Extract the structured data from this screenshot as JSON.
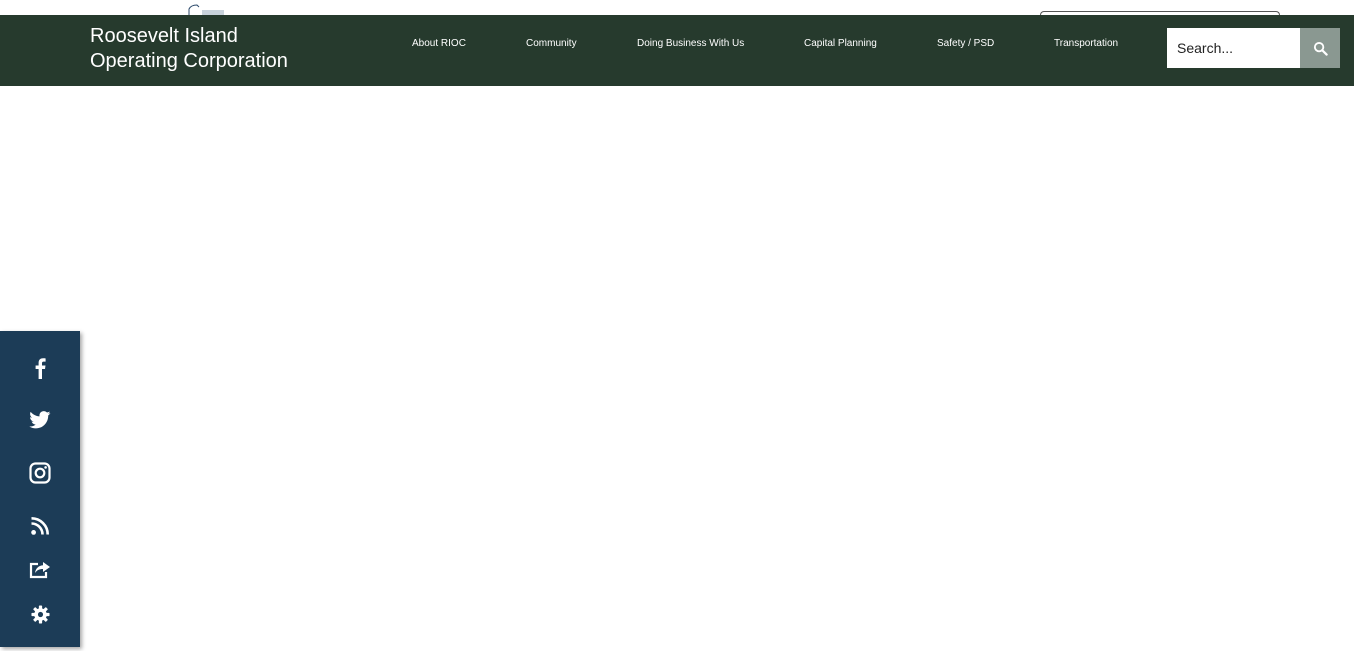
{
  "header": {
    "brand_line1": "Roosevelt Island",
    "brand_line2": "Operating Corporation",
    "background": "#263a2d"
  },
  "nav": {
    "items": [
      {
        "label": "About RIOC"
      },
      {
        "label": "Community"
      },
      {
        "label": "Doing Business With Us"
      },
      {
        "label": "Capital Planning"
      },
      {
        "label": "Safety / PSD"
      },
      {
        "label": "Transportation"
      }
    ]
  },
  "search": {
    "placeholder": "Search...",
    "button_icon": "search-icon"
  },
  "social_sidebar": {
    "background": "#1c3c57",
    "items": [
      {
        "icon": "facebook-icon"
      },
      {
        "icon": "twitter-icon"
      },
      {
        "icon": "instagram-icon"
      },
      {
        "icon": "rss-icon"
      },
      {
        "icon": "share-icon"
      },
      {
        "icon": "gear-icon"
      }
    ]
  }
}
